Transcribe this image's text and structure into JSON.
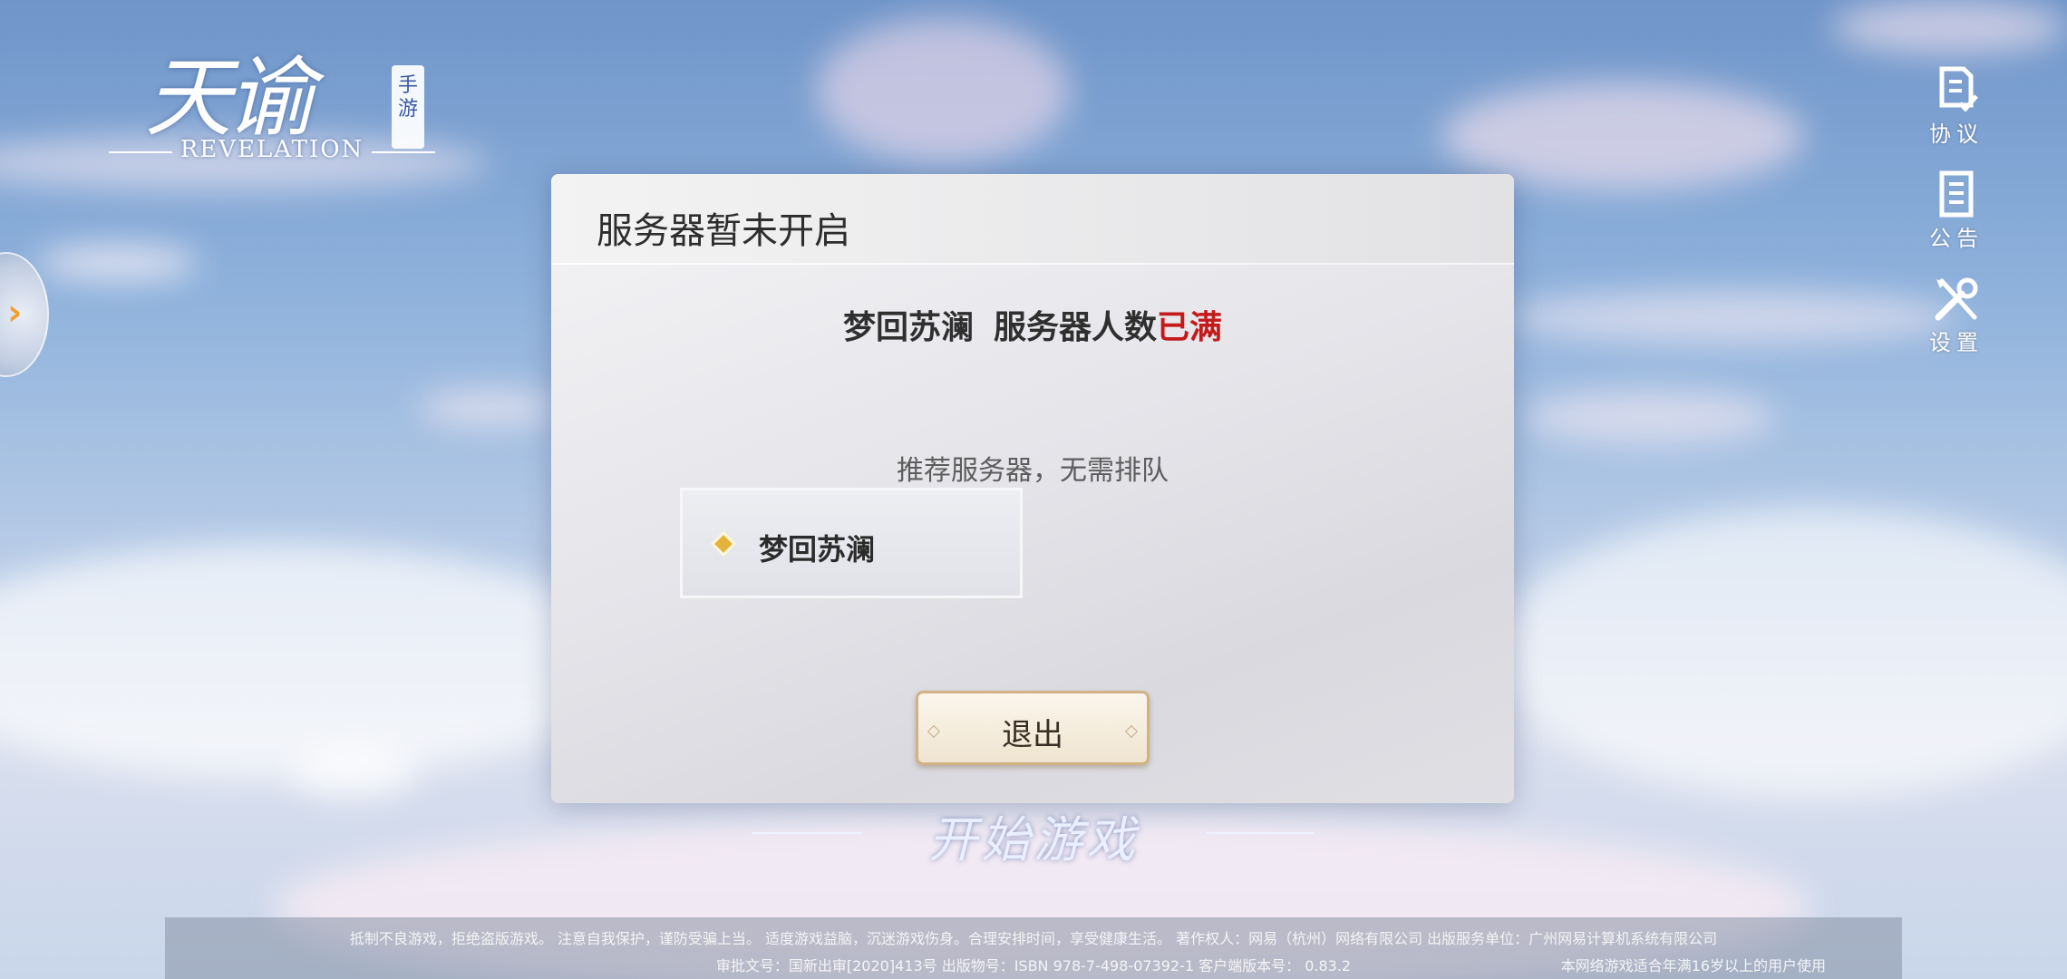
{
  "logo": {
    "title": "天谕",
    "tag": "手游",
    "subtitle": "REVELATION"
  },
  "right_menu": [
    {
      "label": "协议",
      "icon": "agreement-icon"
    },
    {
      "label": "公告",
      "icon": "announcement-icon"
    },
    {
      "label": "设置",
      "icon": "settings-icon"
    }
  ],
  "side_tab": {
    "icon": "chevron-right-icon",
    "glyph": "›"
  },
  "dialog": {
    "title": "服务器暂未开启",
    "status_server": "梦回苏澜",
    "status_prefix": "服务器人数",
    "status_full": "已满",
    "hint": "推荐服务器，无需排队",
    "recommended_server": "梦回苏澜",
    "exit_label": "退出"
  },
  "start_game": {
    "label": "开始游戏"
  },
  "footer": {
    "line1": "抵制不良游戏，拒绝盗版游戏。 注意自我保护，谨防受骗上当。 适度游戏益脑，沉迷游戏伤身。合理安排时间，享受健康生活。 著作权人：网易（杭州）网络有限公司 出版服务单位：广州网易计算机系统有限公司",
    "line2": "审批文号：国新出审[2020]413号 出版物号：ISBN 978-7-498-07392-1 客户端版本号： 0.83.2",
    "age_notice": "本网络游戏适合年满16岁以上的用户使用"
  },
  "colors": {
    "status_full": "#c41a1a",
    "diamond": "#e4b33c",
    "exit_border": "#d1b285"
  }
}
